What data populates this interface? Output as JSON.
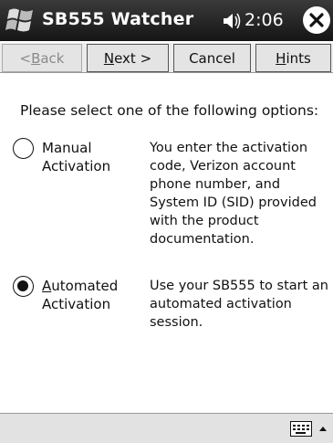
{
  "titlebar": {
    "app_title": "SB555 Watcher",
    "time": "2:06"
  },
  "wizard": {
    "back": {
      "pre": "< ",
      "ul": "B",
      "post": "ack"
    },
    "next": {
      "pre": "",
      "ul": "N",
      "post": "ext >"
    },
    "cancel": "Cancel",
    "hints": {
      "pre": "",
      "ul": "H",
      "post": "ints"
    }
  },
  "content": {
    "prompt": "Please select one of the following options:",
    "options": [
      {
        "label_ul": "",
        "label_rest": "Manual",
        "label_line2": "Activation",
        "selected": false,
        "description": "You enter the activation code, Verizon account phone number, and System ID (SID) provided with the product documentation."
      },
      {
        "label_ul": "A",
        "label_rest": "utomated",
        "label_line2": "Activation",
        "selected": true,
        "description": "Use your SB555 to start an automated activation session."
      }
    ]
  },
  "icons": {
    "start": "windows-flag-icon",
    "volume": "speaker-icon",
    "close": "close-icon",
    "input": "keyboard-icon",
    "input_menu": "up-arrow-icon"
  }
}
